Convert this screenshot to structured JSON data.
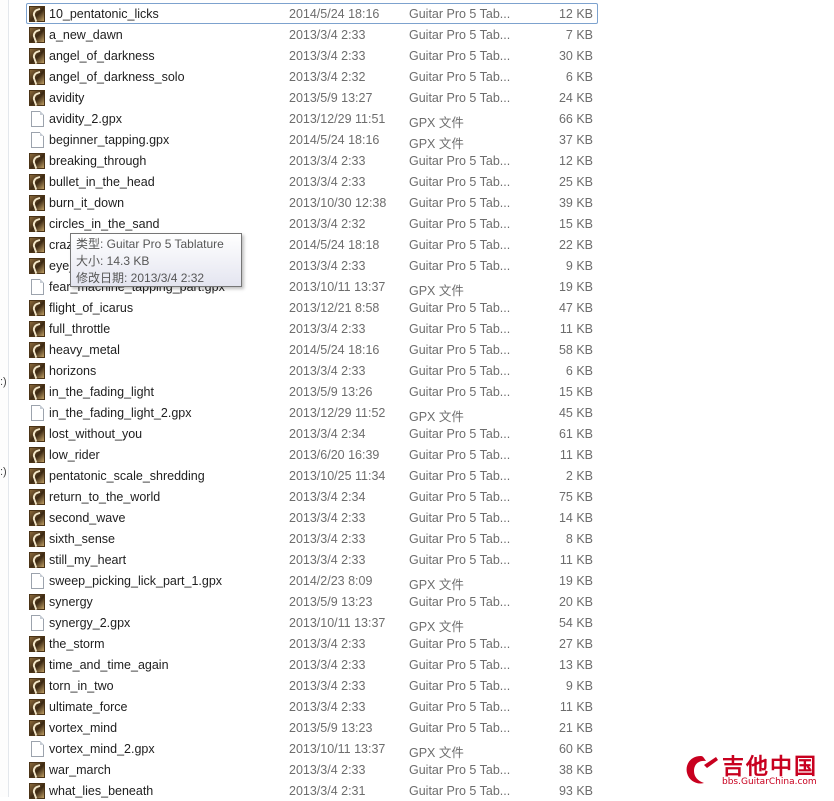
{
  "left_pane_marks": [
    ":)",
    ":)"
  ],
  "files": [
    {
      "name": "10_pentatonic_licks",
      "date": "2014/5/24 18:16",
      "type": "Guitar Pro 5 Tab...",
      "size": "12 KB",
      "icon": "guitar-pro-icon",
      "selected": true
    },
    {
      "name": "a_new_dawn",
      "date": "2013/3/4 2:33",
      "type": "Guitar Pro 5 Tab...",
      "size": "7 KB",
      "icon": "guitar-pro-icon"
    },
    {
      "name": "angel_of_darkness",
      "date": "2013/3/4 2:33",
      "type": "Guitar Pro 5 Tab...",
      "size": "30 KB",
      "icon": "guitar-pro-icon"
    },
    {
      "name": "angel_of_darkness_solo",
      "date": "2013/3/4 2:32",
      "type": "Guitar Pro 5 Tab...",
      "size": "6 KB",
      "icon": "guitar-pro-icon"
    },
    {
      "name": "avidity",
      "date": "2013/5/9 13:27",
      "type": "Guitar Pro 5 Tab...",
      "size": "24 KB",
      "icon": "guitar-pro-icon"
    },
    {
      "name": "avidity_2.gpx",
      "date": "2013/12/29 11:51",
      "type": "GPX 文件",
      "size": "66 KB",
      "icon": "file-icon"
    },
    {
      "name": "beginner_tapping.gpx",
      "date": "2014/5/24 18:16",
      "type": "GPX 文件",
      "size": "37 KB",
      "icon": "file-icon"
    },
    {
      "name": "breaking_through",
      "date": "2013/3/4 2:33",
      "type": "Guitar Pro 5 Tab...",
      "size": "12 KB",
      "icon": "guitar-pro-icon"
    },
    {
      "name": "bullet_in_the_head",
      "date": "2013/3/4 2:33",
      "type": "Guitar Pro 5 Tab...",
      "size": "25 KB",
      "icon": "guitar-pro-icon"
    },
    {
      "name": "burn_it_down",
      "date": "2013/10/30 12:38",
      "type": "Guitar Pro 5 Tab...",
      "size": "39 KB",
      "icon": "guitar-pro-icon"
    },
    {
      "name": "circles_in_the_sand",
      "date": "2013/3/4 2:32",
      "type": "Guitar Pro 5 Tab...",
      "size": "15 KB",
      "icon": "guitar-pro-icon"
    },
    {
      "name": "crazy_train",
      "date": "2014/5/24 18:18",
      "type": "Guitar Pro 5 Tab...",
      "size": "22 KB",
      "icon": "guitar-pro-icon"
    },
    {
      "name": "eye_of_the_storm",
      "date": "2013/3/4 2:33",
      "type": "Guitar Pro 5 Tab...",
      "size": "9 KB",
      "icon": "guitar-pro-icon"
    },
    {
      "name": "fear_machine_tapping_part.gpx",
      "date": "2013/10/11 13:37",
      "type": "GPX 文件",
      "size": "19 KB",
      "icon": "file-icon"
    },
    {
      "name": "flight_of_icarus",
      "date": "2013/12/21 8:58",
      "type": "Guitar Pro 5 Tab...",
      "size": "47 KB",
      "icon": "guitar-pro-icon"
    },
    {
      "name": "full_throttle",
      "date": "2013/3/4 2:33",
      "type": "Guitar Pro 5 Tab...",
      "size": "11 KB",
      "icon": "guitar-pro-icon"
    },
    {
      "name": "heavy_metal",
      "date": "2014/5/24 18:16",
      "type": "Guitar Pro 5 Tab...",
      "size": "58 KB",
      "icon": "guitar-pro-icon"
    },
    {
      "name": "horizons",
      "date": "2013/3/4 2:33",
      "type": "Guitar Pro 5 Tab...",
      "size": "6 KB",
      "icon": "guitar-pro-icon"
    },
    {
      "name": "in_the_fading_light",
      "date": "2013/5/9 13:26",
      "type": "Guitar Pro 5 Tab...",
      "size": "15 KB",
      "icon": "guitar-pro-icon"
    },
    {
      "name": "in_the_fading_light_2.gpx",
      "date": "2013/12/29 11:52",
      "type": "GPX 文件",
      "size": "45 KB",
      "icon": "file-icon"
    },
    {
      "name": "lost_without_you",
      "date": "2013/3/4 2:34",
      "type": "Guitar Pro 5 Tab...",
      "size": "61 KB",
      "icon": "guitar-pro-icon"
    },
    {
      "name": "low_rider",
      "date": "2013/6/20 16:39",
      "type": "Guitar Pro 5 Tab...",
      "size": "11 KB",
      "icon": "guitar-pro-icon"
    },
    {
      "name": "pentatonic_scale_shredding",
      "date": "2013/10/25 11:34",
      "type": "Guitar Pro 5 Tab...",
      "size": "2 KB",
      "icon": "guitar-pro-icon"
    },
    {
      "name": "return_to_the_world",
      "date": "2013/3/4 2:34",
      "type": "Guitar Pro 5 Tab...",
      "size": "75 KB",
      "icon": "guitar-pro-icon"
    },
    {
      "name": "second_wave",
      "date": "2013/3/4 2:33",
      "type": "Guitar Pro 5 Tab...",
      "size": "14 KB",
      "icon": "guitar-pro-icon"
    },
    {
      "name": "sixth_sense",
      "date": "2013/3/4 2:33",
      "type": "Guitar Pro 5 Tab...",
      "size": "8 KB",
      "icon": "guitar-pro-icon"
    },
    {
      "name": "still_my_heart",
      "date": "2013/3/4 2:33",
      "type": "Guitar Pro 5 Tab...",
      "size": "11 KB",
      "icon": "guitar-pro-icon"
    },
    {
      "name": "sweep_picking_lick_part_1.gpx",
      "date": "2014/2/23 8:09",
      "type": "GPX 文件",
      "size": "19 KB",
      "icon": "file-icon"
    },
    {
      "name": "synergy",
      "date": "2013/5/9 13:23",
      "type": "Guitar Pro 5 Tab...",
      "size": "20 KB",
      "icon": "guitar-pro-icon"
    },
    {
      "name": "synergy_2.gpx",
      "date": "2013/10/11 13:37",
      "type": "GPX 文件",
      "size": "54 KB",
      "icon": "file-icon"
    },
    {
      "name": "the_storm",
      "date": "2013/3/4 2:33",
      "type": "Guitar Pro 5 Tab...",
      "size": "27 KB",
      "icon": "guitar-pro-icon"
    },
    {
      "name": "time_and_time_again",
      "date": "2013/3/4 2:33",
      "type": "Guitar Pro 5 Tab...",
      "size": "13 KB",
      "icon": "guitar-pro-icon"
    },
    {
      "name": "torn_in_two",
      "date": "2013/3/4 2:33",
      "type": "Guitar Pro 5 Tab...",
      "size": "9 KB",
      "icon": "guitar-pro-icon"
    },
    {
      "name": "ultimate_force",
      "date": "2013/3/4 2:33",
      "type": "Guitar Pro 5 Tab...",
      "size": "11 KB",
      "icon": "guitar-pro-icon"
    },
    {
      "name": "vortex_mind",
      "date": "2013/5/9 13:23",
      "type": "Guitar Pro 5 Tab...",
      "size": "21 KB",
      "icon": "guitar-pro-icon"
    },
    {
      "name": "vortex_mind_2.gpx",
      "date": "2013/10/11 13:37",
      "type": "GPX 文件",
      "size": "60 KB",
      "icon": "file-icon"
    },
    {
      "name": "war_march",
      "date": "2013/3/4 2:33",
      "type": "Guitar Pro 5 Tab...",
      "size": "38 KB",
      "icon": "guitar-pro-icon"
    },
    {
      "name": "what_lies_beneath",
      "date": "2013/3/4 2:31",
      "type": "Guitar Pro 5 Tab...",
      "size": "93 KB",
      "icon": "guitar-pro-icon"
    }
  ],
  "tooltip": {
    "type_line": "类型: Guitar Pro 5 Tablature",
    "size_line": "大小: 14.3 KB",
    "date_line": "修改日期: 2013/3/4 2:32"
  },
  "watermark": {
    "title": "吉他中国",
    "subtitle": "bbs.GuitarChina.com",
    "color": "#c8001f"
  }
}
